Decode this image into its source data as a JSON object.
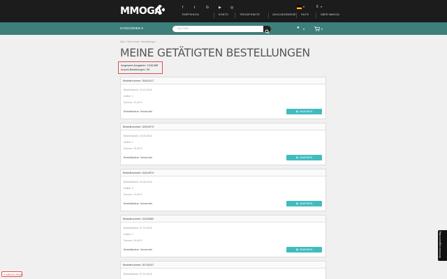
{
  "header": {
    "logo": "MMOGA",
    "social_icons": [
      "facebook-icon",
      "twitter-icon",
      "google-plus-icon",
      "youtube-icon",
      "instagram-icon"
    ],
    "nav": [
      "Empfehlen",
      "Konto",
      "Treuepunkte",
      "Zahlungsweise",
      "Hilfe",
      "Über MMOGA"
    ],
    "currency": "€",
    "language_flag": "de"
  },
  "catbar": {
    "categories": "Kategorien",
    "search_placeholder": "Suchen ..."
  },
  "breadcrumb": "Start / Mein Konto / Bestellungen",
  "page": {
    "title": "Meine getätigten Bestellungen"
  },
  "summary": {
    "total_spent": "Insgesamt Ausgaben: 1345,58€",
    "total_orders": "Anzahl Bestellungen: 95"
  },
  "orders": [
    {
      "number": "Bestellnummer: 35410417",
      "date": "Bestelldatum: 03.10.2018",
      "items": "Artikel: 1",
      "sum": "Summe: 23,44 €",
      "status": "Bestellstatus: Versendet",
      "button": "Anzeigen"
    },
    {
      "number": "Bestellnummer: 34919270",
      "date": "Bestelldatum: 15.09.2018",
      "items": "Artikel: 1",
      "sum": "Summe: 16,99 €",
      "status": "Bestellstatus: Versendet",
      "button": "Anzeigen"
    },
    {
      "number": "Bestellnummer: 31610574",
      "date": "Bestelldatum: 22.05.2018",
      "items": "Artikel: 2",
      "sum": "Summe: 13,90 €",
      "status": "Bestellstatus: Versendet",
      "button": "Anzeigen"
    },
    {
      "number": "Bestellnummer: 31100660",
      "date": "Bestelldatum: 27.04.2018",
      "items": "Artikel: 1",
      "sum": "Summe: 34,90 €",
      "status": "Bestellstatus: Versendet",
      "button": "Anzeigen"
    },
    {
      "number": "Bestellnummer: 30734247",
      "date": "Bestelldatum: 07.04.2018",
      "items": "",
      "sum": "",
      "status": "",
      "button": ""
    }
  ],
  "feedback_tab": "Verbesserungsvorschlag",
  "corner_badge": "MMOGA Helper",
  "colors": {
    "topbar": "#1c1c1c",
    "catbar": "#3c7f7b",
    "button": "#3fbcbd",
    "highlight": "#d9534f"
  }
}
